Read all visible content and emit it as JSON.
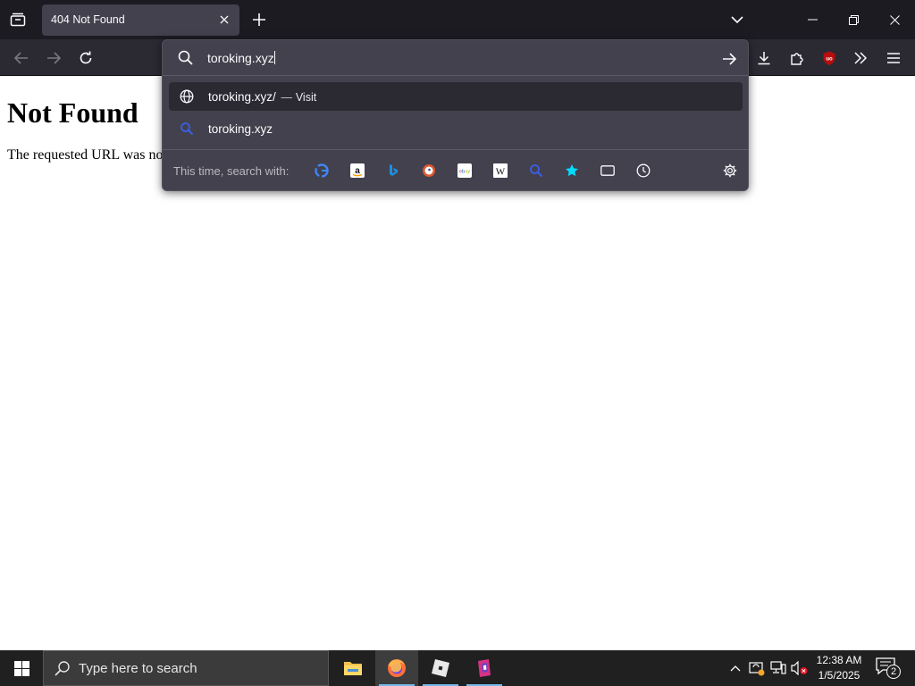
{
  "browser": {
    "tab": {
      "title": "404 Not Found"
    },
    "url_bar": {
      "value": "toroking.xyz"
    },
    "suggestions": [
      {
        "text": "toroking.xyz/",
        "separator": "—",
        "action": "Visit",
        "icon": "globe-icon",
        "selected": true
      },
      {
        "text": "toroking.xyz",
        "icon": "search-icon",
        "selected": false
      }
    ],
    "one_off": {
      "label": "This time, search with:",
      "engines": [
        "google",
        "amazon",
        "bing",
        "duckduckgo",
        "ebay",
        "wikipedia",
        "search",
        "bookmarks",
        "tabs",
        "history"
      ]
    }
  },
  "page": {
    "heading": "Not Found",
    "message": "The requested URL was no"
  },
  "taskbar": {
    "search_placeholder": "Type here to search",
    "clock": {
      "time": "12:38 AM",
      "date": "1/5/2025"
    },
    "notification_count": "2"
  },
  "colors": {
    "tabbar_bg": "#1c1b22",
    "navbar_bg": "#2b2a33",
    "panel_bg": "#42414d",
    "taskbar_bg": "#202020",
    "accent": "#76b9ed"
  }
}
